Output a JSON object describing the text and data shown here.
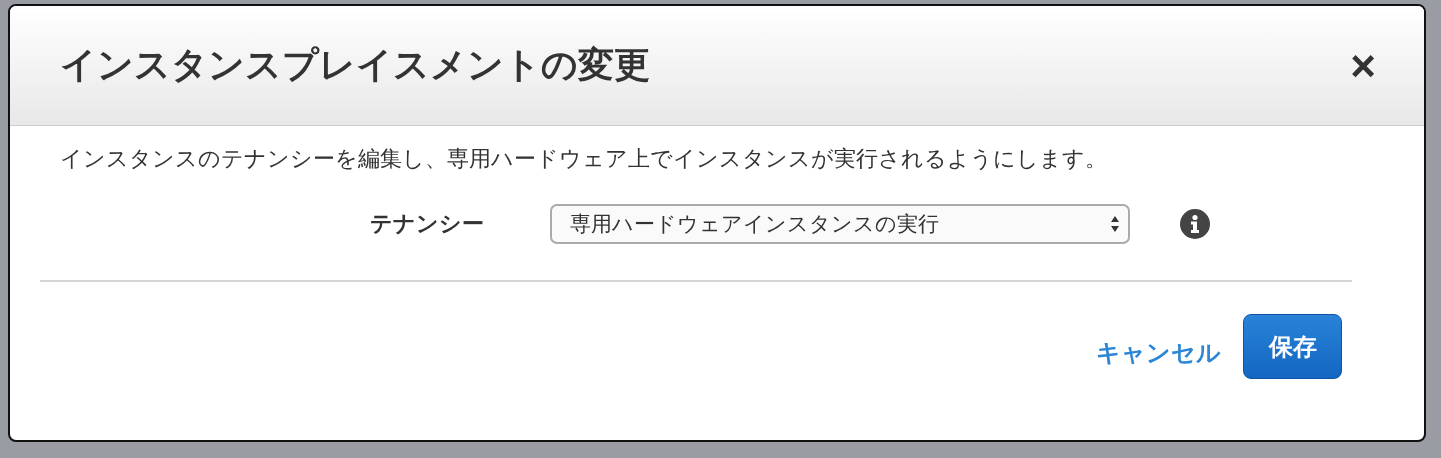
{
  "dialog": {
    "title": "インスタンスプレイスメントの変更",
    "close": "×",
    "description": "インスタンスのテナンシーを編集し、専用ハードウェア上でインスタンスが実行されるようにします。",
    "tenancy": {
      "label": "テナンシー",
      "value": "専用ハードウェアインスタンスの実行"
    },
    "buttons": [
      {
        "label": "キャンセル",
        "kind": "link"
      },
      {
        "label": "保存",
        "kind": "primary"
      }
    ]
  }
}
